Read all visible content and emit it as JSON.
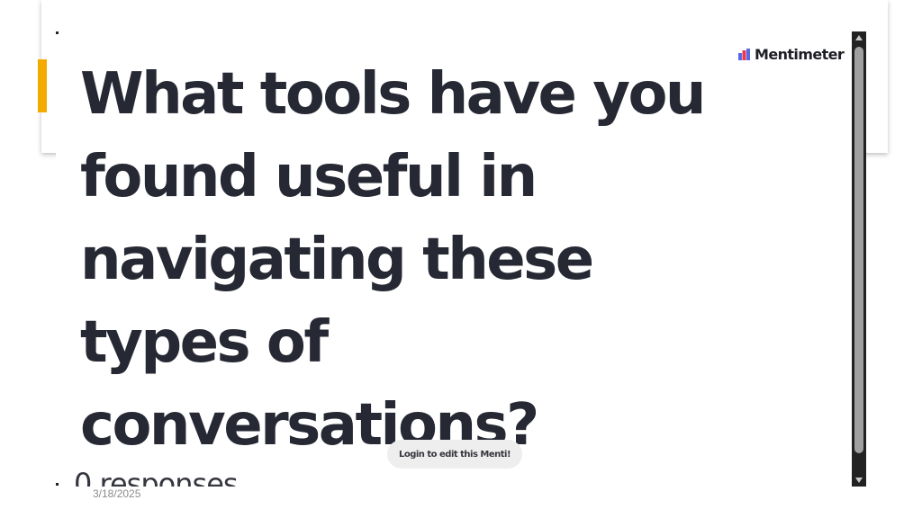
{
  "embed": {
    "brand_name": "Mentimeter",
    "question": "What tools have you found useful in navigating these types of conversations?",
    "responses_label": "0 responses",
    "login_button_label": "Login to edit this Menti!"
  },
  "slide": {
    "date": "3/18/2025"
  },
  "colors": {
    "accent": "#f4ab00",
    "text": "#262833",
    "brand_red": "#e8384f",
    "brand_blue": "#5769e7"
  },
  "icons": {
    "brand": "mentimeter-logo-icon",
    "scroll_up": "chevron-up-icon",
    "scroll_down": "chevron-down-icon"
  }
}
